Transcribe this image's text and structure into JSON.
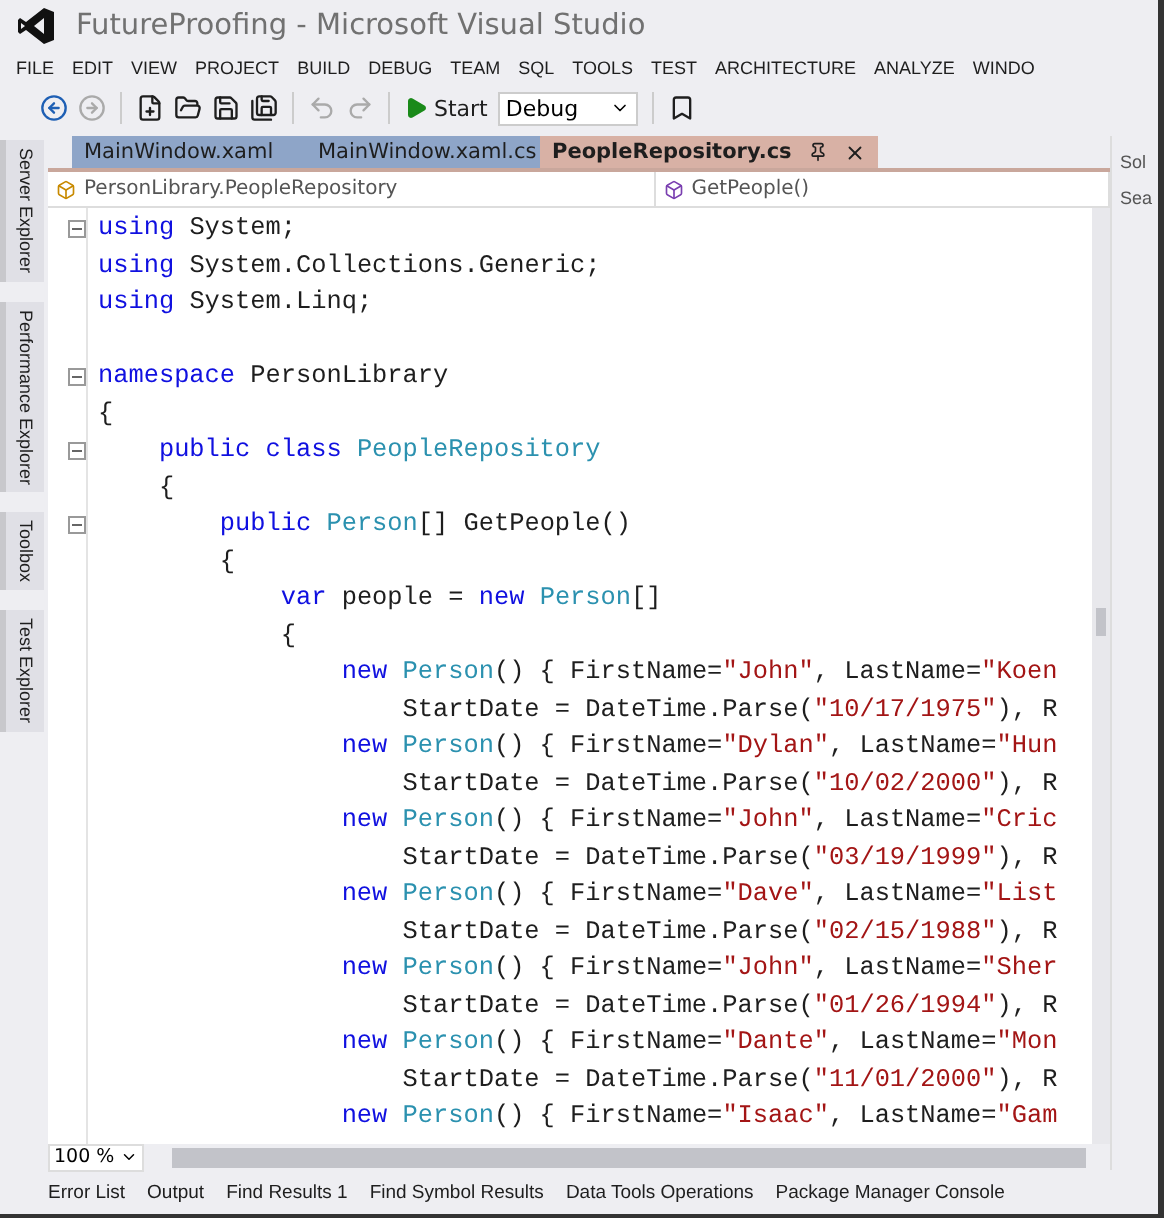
{
  "window": {
    "title": "FutureProofing - Microsoft Visual Studio"
  },
  "menu": [
    "FILE",
    "EDIT",
    "VIEW",
    "PROJECT",
    "BUILD",
    "DEBUG",
    "TEAM",
    "SQL",
    "TOOLS",
    "TEST",
    "ARCHITECTURE",
    "ANALYZE",
    "WINDO"
  ],
  "toolbar": {
    "start": "Start",
    "configuration": "Debug"
  },
  "side_tabs": [
    "Server Explorer",
    "Performance Explorer",
    "Toolbox",
    "Test Explorer"
  ],
  "doc_tabs": [
    {
      "label": "MainWindow.xaml",
      "selected": false
    },
    {
      "label": "MainWindow.xaml.cs",
      "selected": false
    },
    {
      "label": "PeopleRepository.cs",
      "selected": true
    }
  ],
  "nav_bar": {
    "type": "PersonLibrary.PeopleRepository",
    "member": "GetPeople()"
  },
  "code": [
    {
      "fold": true,
      "gap_before": false,
      "segments": [
        {
          "kind": "kw",
          "text": "using "
        },
        {
          "kind": "plain",
          "text": "System;"
        }
      ]
    },
    {
      "fold": false,
      "gap_before": false,
      "segments": [
        {
          "kind": "kw",
          "text": "using "
        },
        {
          "kind": "plain",
          "text": "System.Collections.Generic;"
        }
      ]
    },
    {
      "fold": false,
      "gap_before": false,
      "segments": [
        {
          "kind": "kw",
          "text": "using "
        },
        {
          "kind": "plain",
          "text": "System.Linq;"
        }
      ]
    },
    {
      "fold": true,
      "gap_before": true,
      "segments": [
        {
          "kind": "kw",
          "text": "namespace "
        },
        {
          "kind": "plain",
          "text": "PersonLibrary"
        }
      ]
    },
    {
      "fold": false,
      "gap_before": false,
      "segments": [
        {
          "kind": "plain",
          "text": "{"
        }
      ]
    },
    {
      "fold": true,
      "gap_before": false,
      "segments": [
        {
          "kind": "kw",
          "text": "    public class "
        },
        {
          "kind": "type",
          "text": "PeopleRepository"
        }
      ]
    },
    {
      "fold": false,
      "gap_before": false,
      "segments": [
        {
          "kind": "plain",
          "text": "    {"
        }
      ]
    },
    {
      "fold": true,
      "gap_before": false,
      "segments": [
        {
          "kind": "kw",
          "text": "        public "
        },
        {
          "kind": "type",
          "text": "Person"
        },
        {
          "kind": "plain",
          "text": "[] GetPeople()"
        }
      ]
    },
    {
      "fold": false,
      "gap_before": false,
      "segments": [
        {
          "kind": "plain",
          "text": "        {"
        }
      ]
    },
    {
      "fold": false,
      "gap_before": false,
      "segments": [
        {
          "kind": "kw",
          "text": "            var"
        },
        {
          "kind": "plain",
          "text": " people = "
        },
        {
          "kind": "kw",
          "text": "new "
        },
        {
          "kind": "type",
          "text": "Person"
        },
        {
          "kind": "plain",
          "text": "[]"
        }
      ]
    },
    {
      "fold": false,
      "gap_before": false,
      "segments": [
        {
          "kind": "plain",
          "text": "            {"
        }
      ]
    },
    {
      "fold": false,
      "gap_before": false,
      "segments": [
        {
          "kind": "kw",
          "text": "                new "
        },
        {
          "kind": "type",
          "text": "Person"
        },
        {
          "kind": "plain",
          "text": "() { FirstName="
        },
        {
          "kind": "str",
          "text": "\"John\""
        },
        {
          "kind": "plain",
          "text": ", LastName="
        },
        {
          "kind": "str",
          "text": "\"Koen"
        }
      ]
    },
    {
      "fold": false,
      "gap_before": false,
      "segments": [
        {
          "kind": "plain",
          "text": "                    StartDate = DateTime.Parse("
        },
        {
          "kind": "str",
          "text": "\"10/17/1975\""
        },
        {
          "kind": "plain",
          "text": "), R"
        }
      ]
    },
    {
      "fold": false,
      "gap_before": false,
      "segments": [
        {
          "kind": "kw",
          "text": "                new "
        },
        {
          "kind": "type",
          "text": "Person"
        },
        {
          "kind": "plain",
          "text": "() { FirstName="
        },
        {
          "kind": "str",
          "text": "\"Dylan\""
        },
        {
          "kind": "plain",
          "text": ", LastName="
        },
        {
          "kind": "str",
          "text": "\"Hun"
        }
      ]
    },
    {
      "fold": false,
      "gap_before": false,
      "segments": [
        {
          "kind": "plain",
          "text": "                    StartDate = DateTime.Parse("
        },
        {
          "kind": "str",
          "text": "\"10/02/2000\""
        },
        {
          "kind": "plain",
          "text": "), R"
        }
      ]
    },
    {
      "fold": false,
      "gap_before": false,
      "segments": [
        {
          "kind": "kw",
          "text": "                new "
        },
        {
          "kind": "type",
          "text": "Person"
        },
        {
          "kind": "plain",
          "text": "() { FirstName="
        },
        {
          "kind": "str",
          "text": "\"John\""
        },
        {
          "kind": "plain",
          "text": ", LastName="
        },
        {
          "kind": "str",
          "text": "\"Cric"
        }
      ]
    },
    {
      "fold": false,
      "gap_before": false,
      "segments": [
        {
          "kind": "plain",
          "text": "                    StartDate = DateTime.Parse("
        },
        {
          "kind": "str",
          "text": "\"03/19/1999\""
        },
        {
          "kind": "plain",
          "text": "), R"
        }
      ]
    },
    {
      "fold": false,
      "gap_before": false,
      "segments": [
        {
          "kind": "kw",
          "text": "                new "
        },
        {
          "kind": "type",
          "text": "Person"
        },
        {
          "kind": "plain",
          "text": "() { FirstName="
        },
        {
          "kind": "str",
          "text": "\"Dave\""
        },
        {
          "kind": "plain",
          "text": ", LastName="
        },
        {
          "kind": "str",
          "text": "\"List"
        }
      ]
    },
    {
      "fold": false,
      "gap_before": false,
      "segments": [
        {
          "kind": "plain",
          "text": "                    StartDate = DateTime.Parse("
        },
        {
          "kind": "str",
          "text": "\"02/15/1988\""
        },
        {
          "kind": "plain",
          "text": "), R"
        }
      ]
    },
    {
      "fold": false,
      "gap_before": false,
      "segments": [
        {
          "kind": "kw",
          "text": "                new "
        },
        {
          "kind": "type",
          "text": "Person"
        },
        {
          "kind": "plain",
          "text": "() { FirstName="
        },
        {
          "kind": "str",
          "text": "\"John\""
        },
        {
          "kind": "plain",
          "text": ", LastName="
        },
        {
          "kind": "str",
          "text": "\"Sher"
        }
      ]
    },
    {
      "fold": false,
      "gap_before": false,
      "segments": [
        {
          "kind": "plain",
          "text": "                    StartDate = DateTime.Parse("
        },
        {
          "kind": "str",
          "text": "\"01/26/1994\""
        },
        {
          "kind": "plain",
          "text": "), R"
        }
      ]
    },
    {
      "fold": false,
      "gap_before": false,
      "segments": [
        {
          "kind": "kw",
          "text": "                new "
        },
        {
          "kind": "type",
          "text": "Person"
        },
        {
          "kind": "plain",
          "text": "() { FirstName="
        },
        {
          "kind": "str",
          "text": "\"Dante\""
        },
        {
          "kind": "plain",
          "text": ", LastName="
        },
        {
          "kind": "str",
          "text": "\"Mon"
        }
      ]
    },
    {
      "fold": false,
      "gap_before": false,
      "segments": [
        {
          "kind": "plain",
          "text": "                    StartDate = DateTime.Parse("
        },
        {
          "kind": "str",
          "text": "\"11/01/2000\""
        },
        {
          "kind": "plain",
          "text": "), R"
        }
      ]
    },
    {
      "fold": false,
      "gap_before": false,
      "segments": [
        {
          "kind": "kw",
          "text": "                new "
        },
        {
          "kind": "type",
          "text": "Person"
        },
        {
          "kind": "plain",
          "text": "() { FirstName="
        },
        {
          "kind": "str",
          "text": "\"Isaac\""
        },
        {
          "kind": "plain",
          "text": ", LastName="
        },
        {
          "kind": "str",
          "text": "\"Gam"
        }
      ]
    }
  ],
  "zoom": "100 %",
  "right_panel": {
    "title": "Sol",
    "search": "Sea"
  },
  "bottom_tabs": [
    "Error List",
    "Output",
    "Find Results 1",
    "Find Symbol Results",
    "Data Tools Operations",
    "Package Manager Console"
  ]
}
